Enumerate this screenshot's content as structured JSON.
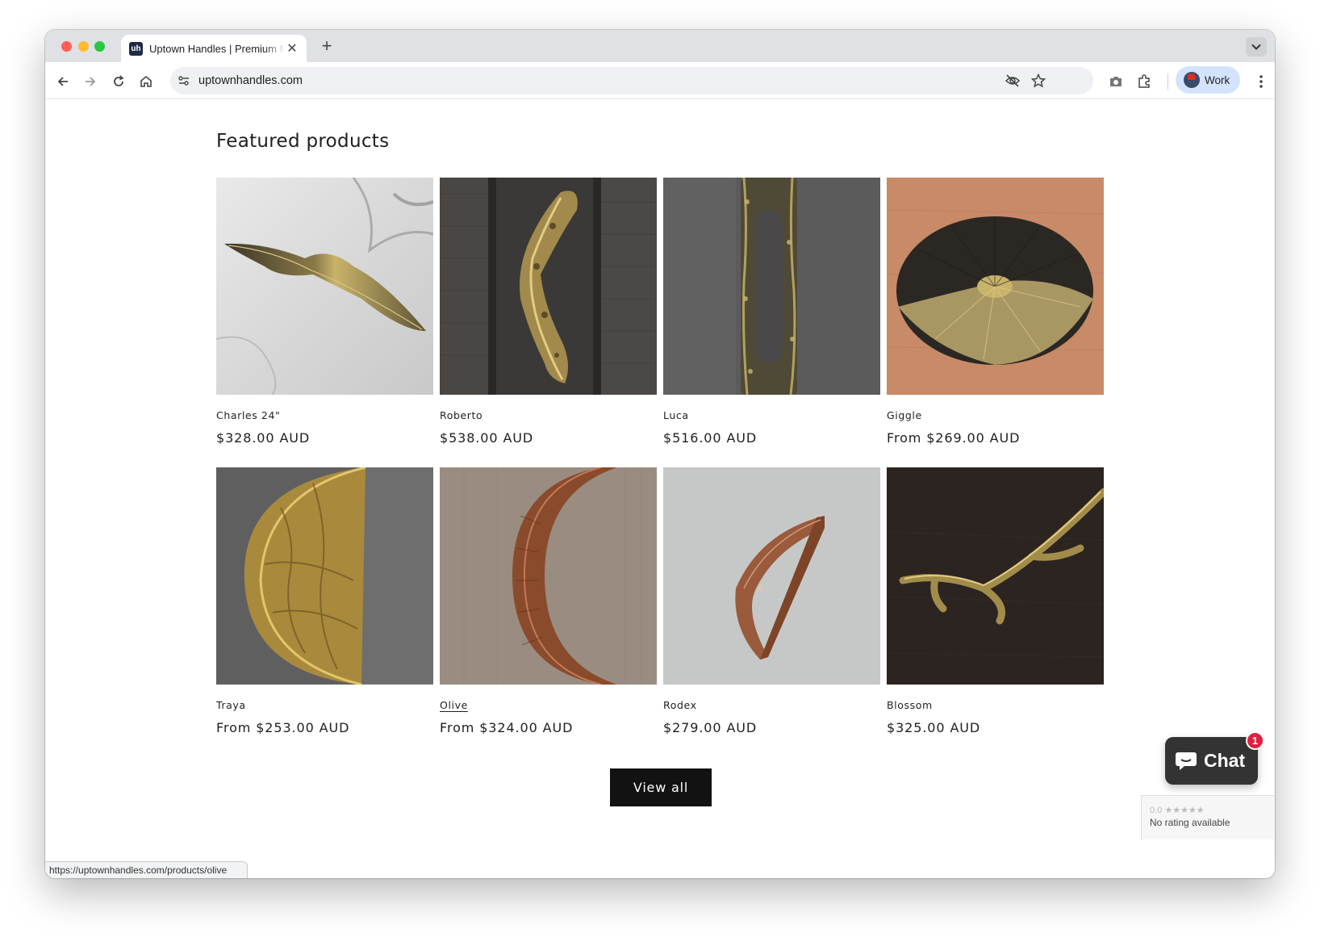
{
  "browser": {
    "tab_title": "Uptown Handles | Premium Modern Cabinet Handles",
    "favicon_text": "uh",
    "url": "uptownhandles.com",
    "profile_label": "Work",
    "status_url": "https://uptownhandles.com/products/olive"
  },
  "page": {
    "section_title": "Featured products",
    "products": [
      {
        "name": "Charles 24\"",
        "price": "$328.00 AUD",
        "image": "marble-background-brass-bar-handle"
      },
      {
        "name": "Roberto",
        "price": "$538.00 AUD",
        "image": "textured-brass-door-pull-dark-wood"
      },
      {
        "name": "Luca",
        "price": "$516.00 AUD",
        "image": "textured-brass-loop-pull-grey"
      },
      {
        "name": "Giggle",
        "price": "From $269.00 AUD",
        "image": "oval-black-brass-knob-wood"
      },
      {
        "name": "Traya",
        "price": "From $253.00 AUD",
        "image": "half-circle-gold-pull-grey"
      },
      {
        "name": "Olive",
        "price": "From $324.00 AUD",
        "image": "copper-arc-pull-wood"
      },
      {
        "name": "Rodex",
        "price": "$279.00 AUD",
        "image": "copper-half-moon-pull-grey"
      },
      {
        "name": "Blossom",
        "price": "$325.00 AUD",
        "image": "brass-branch-handle-dark-wood"
      }
    ],
    "view_all_label": "View all"
  },
  "chat": {
    "label": "Chat",
    "badge_count": "1"
  },
  "rating_widget": {
    "score": "0.0",
    "stars": "★★★★★",
    "text": "No rating available"
  }
}
